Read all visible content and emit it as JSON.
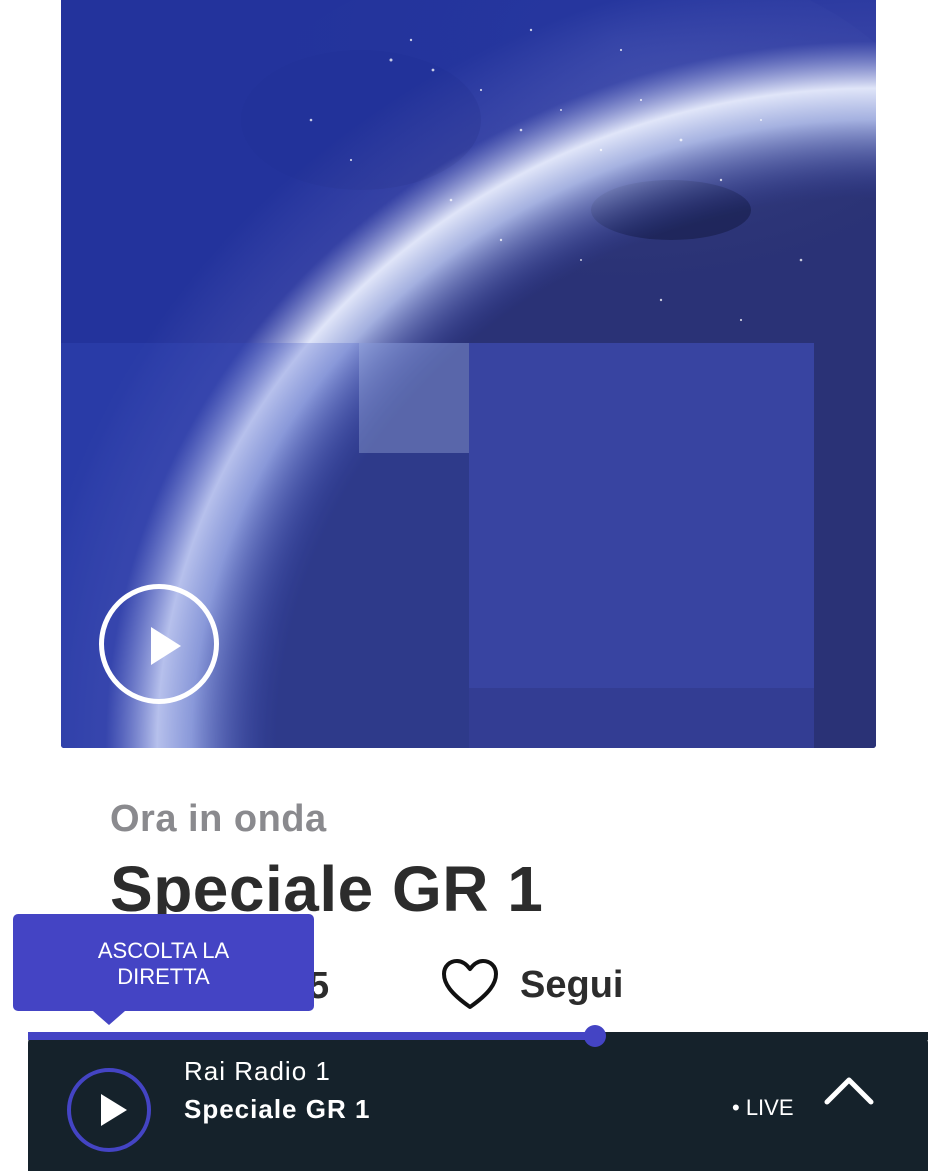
{
  "now_playing_section": {
    "label": "Ora in onda",
    "program_title": "Speciale GR 1",
    "time": "5",
    "follow_label": "Segui"
  },
  "tooltip": {
    "line1": "ASCOLTA LA",
    "line2": "DIRETTA"
  },
  "player": {
    "station": "Rai Radio 1",
    "title": "Speciale GR 1",
    "live_label": "• LIVE",
    "progress": 0.63
  },
  "colors": {
    "accent": "#4444c4",
    "player_bg": "#15222b",
    "label_gray": "#8a8a8e",
    "text_dark": "#2c2c2c"
  },
  "icons": {
    "cover_play": "play-icon",
    "follow": "heart-icon",
    "player_play": "play-icon",
    "expand": "chevron-up-icon"
  }
}
